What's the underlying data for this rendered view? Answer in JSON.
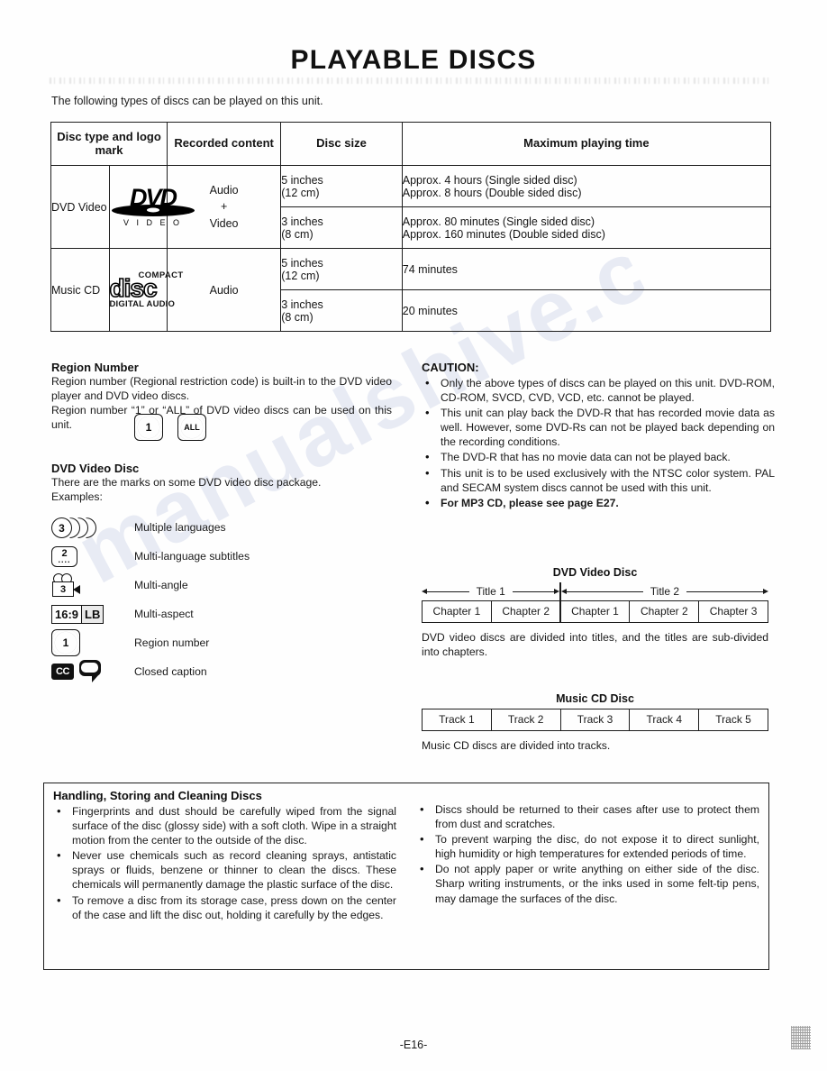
{
  "document": {
    "title": "PLAYABLE DISCS",
    "intro": "The following types of discs can be played on this unit.",
    "page_number": "-E16-",
    "watermark": "manualshive.com"
  },
  "disc_table": {
    "headers": {
      "disc_type": "Disc type and logo mark",
      "recorded_content": "Recorded content",
      "disc_size": "Disc size",
      "max_playing_time": "Maximum playing time"
    },
    "rows": [
      {
        "type": "DVD Video",
        "logo": "dvd-video-logo",
        "logo_text": {
          "word": "DVD",
          "sub": "V I D E O"
        },
        "recorded": "Audio\n+\nVideo",
        "recorded_lines": [
          "Audio",
          "+",
          "Video"
        ],
        "sizes": [
          {
            "size_line1": "5 inches",
            "size_line2": "(12 cm)",
            "time_line1": "Approx. 4 hours (Single sided disc)",
            "time_line2": "Approx. 8 hours (Double sided disc)"
          },
          {
            "size_line1": "3 inches",
            "size_line2": "(8 cm)",
            "time_line1": "Approx. 80 minutes (Single sided disc)",
            "time_line2": "Approx. 160 minutes (Double sided disc)"
          }
        ]
      },
      {
        "type": "Music CD",
        "logo": "compact-disc-digital-audio-logo",
        "logo_text": {
          "compact": "COMPACT",
          "disc": "disc",
          "digital": "DIGITAL AUDIO"
        },
        "recorded": "Audio",
        "recorded_lines": [
          "Audio"
        ],
        "sizes": [
          {
            "size_line1": "5 inches",
            "size_line2": "(12 cm)",
            "time_line1": "74 minutes",
            "time_line2": ""
          },
          {
            "size_line1": "3 inches",
            "size_line2": "(8 cm)",
            "time_line1": "20 minutes",
            "time_line2": ""
          }
        ]
      }
    ]
  },
  "region_number": {
    "heading": "Region Number",
    "para1": "Region number (Regional restriction code) is built-in to the DVD video player and DVD video discs.",
    "para2": "Region number “1” or  “ALL” of DVD video discs can be used on this unit.",
    "badges": [
      "1",
      "ALL"
    ]
  },
  "dvd_video_disc_marks": {
    "heading": "DVD Video Disc",
    "para1": "There are the marks on some DVD video disc package.",
    "para2": "Examples:",
    "marks": [
      {
        "icon": "multiple-languages-icon",
        "value": "3",
        "label": "Multiple languages"
      },
      {
        "icon": "multi-language-subtitles-icon",
        "value": "2",
        "label": "Multi-language subtitles"
      },
      {
        "icon": "multi-angle-icon",
        "value": "3",
        "label": "Multi-angle"
      },
      {
        "icon": "multi-aspect-icon",
        "value": "16:9",
        "value2": "LB",
        "label": "Multi-aspect"
      },
      {
        "icon": "region-number-icon",
        "value": "1",
        "label": "Region number"
      },
      {
        "icon": "closed-caption-icon",
        "value": "CC",
        "label": "Closed caption"
      }
    ]
  },
  "caution": {
    "heading": "CAUTION:",
    "items": [
      {
        "text": "Only the above types of discs can be played on this unit. DVD-ROM, CD-ROM, SVCD, CVD, VCD, etc. cannot be played.",
        "bold": false
      },
      {
        "text": "This unit can play back the DVD-R that has recorded movie data as well. However, some DVD-Rs can not be played back depending on the recording conditions.",
        "bold": false
      },
      {
        "text": "The DVD-R that has no movie data can not be played back.",
        "bold": false
      },
      {
        "text": "This unit is to be used exclusively with the NTSC color system. PAL and SECAM system discs cannot be used with this unit.",
        "bold": false
      },
      {
        "text": "For MP3 CD, please see page E27.",
        "bold": true
      }
    ]
  },
  "dvd_structure": {
    "title": "DVD Video Disc",
    "titles": [
      "Title 1",
      "Title 2"
    ],
    "chapters_title1": [
      "Chapter 1",
      "Chapter 2"
    ],
    "chapters_title2": [
      "Chapter 1",
      "Chapter 2",
      "Chapter 3"
    ],
    "note": "DVD video discs are divided into titles, and the titles are sub-divided into chapters."
  },
  "cd_structure": {
    "title": "Music CD Disc",
    "tracks": [
      "Track 1",
      "Track 2",
      "Track 3",
      "Track 4",
      "Track 5"
    ],
    "note": "Music CD discs are divided into tracks."
  },
  "handling": {
    "heading": "Handling, Storing and Cleaning Discs",
    "left_items": [
      "Fingerprints and dust should be carefully wiped from the signal surface of the disc (glossy side) with a soft cloth. Wipe in a straight motion from the center to the outside of the disc.",
      "Never use chemicals such as record cleaning sprays, antistatic sprays or fluids, benzene or thinner to clean the discs. These chemicals will permanently damage the plastic surface of the disc.",
      "To remove a disc from its storage case, press down on the center of the case and lift the disc out, holding it carefully by the edges."
    ],
    "right_items": [
      "Discs should be returned to their cases after use to protect them from dust and scratches.",
      "To prevent warping the disc, do not expose it to direct sunlight, high humidity or high temperatures for extended periods of time.",
      "Do not apply paper or write anything on either side of the disc. Sharp writing instruments, or the inks used in some felt-tip pens, may damage the surfaces of the disc."
    ]
  }
}
